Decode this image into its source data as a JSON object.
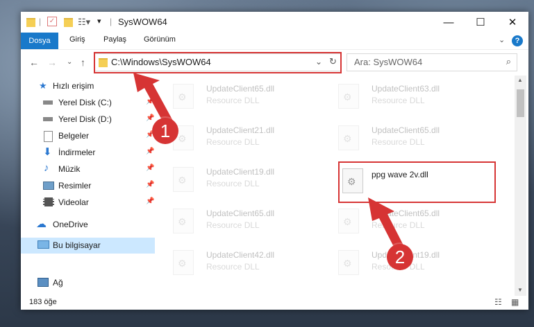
{
  "title_bar": {
    "title": "SysWOW64",
    "separator": "|"
  },
  "ribbon": {
    "file_tab": "Dosya",
    "tabs": [
      "Giriş",
      "Paylaş",
      "Görünüm"
    ],
    "help": "?"
  },
  "address": {
    "path": "C:\\Windows\\SysWOW64",
    "search_placeholder": "Ara: SysWOW64"
  },
  "sidebar": {
    "quick_access": "Hızlı erişim",
    "items": [
      {
        "label": "Yerel Disk (C:)"
      },
      {
        "label": "Yerel Disk (D:)"
      },
      {
        "label": "Belgeler"
      },
      {
        "label": "İndirmeler"
      },
      {
        "label": "Müzik"
      },
      {
        "label": "Resimler"
      },
      {
        "label": "Videolar"
      }
    ],
    "onedrive": "OneDrive",
    "this_pc": "Bu bilgisayar",
    "network": "Ağ"
  },
  "files": [
    {
      "name": "UpdateClient65.dll",
      "type": "Resource DLL"
    },
    {
      "name": "UpdateClient63.dll",
      "type": "Resource DLL"
    },
    {
      "name": "UpdateClient21.dll",
      "type": "Resource DLL"
    },
    {
      "name": "UpdateClient65.dll",
      "type": "Resource DLL"
    },
    {
      "name": "UpdateClient19.dll",
      "type": "Resource DLL"
    },
    {
      "name": "ppg wave 2v.dll",
      "type": ""
    },
    {
      "name": "UpdateClient65.dll",
      "type": "Resource DLL"
    },
    {
      "name": "UpdateClient65.dll",
      "type": "Resource DLL"
    },
    {
      "name": "UpdateClient42.dll",
      "type": "Resource DLL"
    },
    {
      "name": "UpdateClient19.dll",
      "type": "Resource DLL"
    }
  ],
  "status": {
    "count": "183 öğe"
  },
  "annotations": {
    "badge1": "1",
    "badge2": "2"
  },
  "colors": {
    "accent": "#1979ca",
    "highlight": "#d63434"
  }
}
